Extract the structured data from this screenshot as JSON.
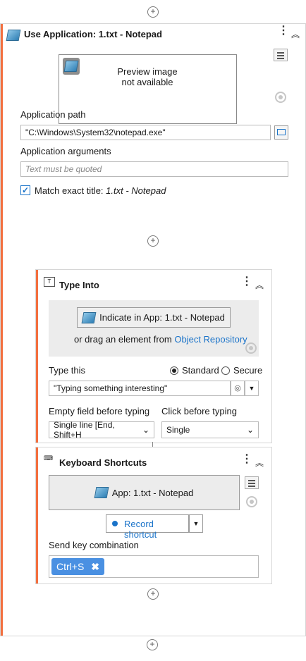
{
  "use_app": {
    "title": "Use Application: 1.txt - Notepad",
    "preview": "Preview image\nnot available",
    "path_label": "Application path",
    "path_value": "\"C:\\Windows\\System32\\notepad.exe\"",
    "args_label": "Application arguments",
    "args_placeholder": "Text must be quoted",
    "match_label": "Match exact title: ",
    "match_value": "1.txt - Notepad",
    "match_checked": true
  },
  "type_into": {
    "title": "Type Into",
    "indicate_button": "Indicate in App: 1.txt - Notepad",
    "drag_text": "or drag an element from ",
    "repo_link": "Object Repository",
    "type_this_label": "Type this",
    "mode_standard": "Standard",
    "mode_secure": "Secure",
    "mode_selected": "Standard",
    "text_value": "\"Typing something interesting\"",
    "empty_field_label": "Empty field before typing",
    "empty_field_value": "Single line [End, Shift+H",
    "click_label": "Click before typing",
    "click_value": "Single"
  },
  "shortcuts": {
    "title": "Keyboard Shortcuts",
    "app_button": "App: 1.txt - Notepad",
    "record_button": "Record shortcut",
    "send_label": "Send key combination",
    "key_chip": "Ctrl+S"
  },
  "colors": {
    "accent": "#f36f3f",
    "link": "#1a73c9",
    "chip": "#4a90e2",
    "checkbox": "#1a73c9"
  }
}
